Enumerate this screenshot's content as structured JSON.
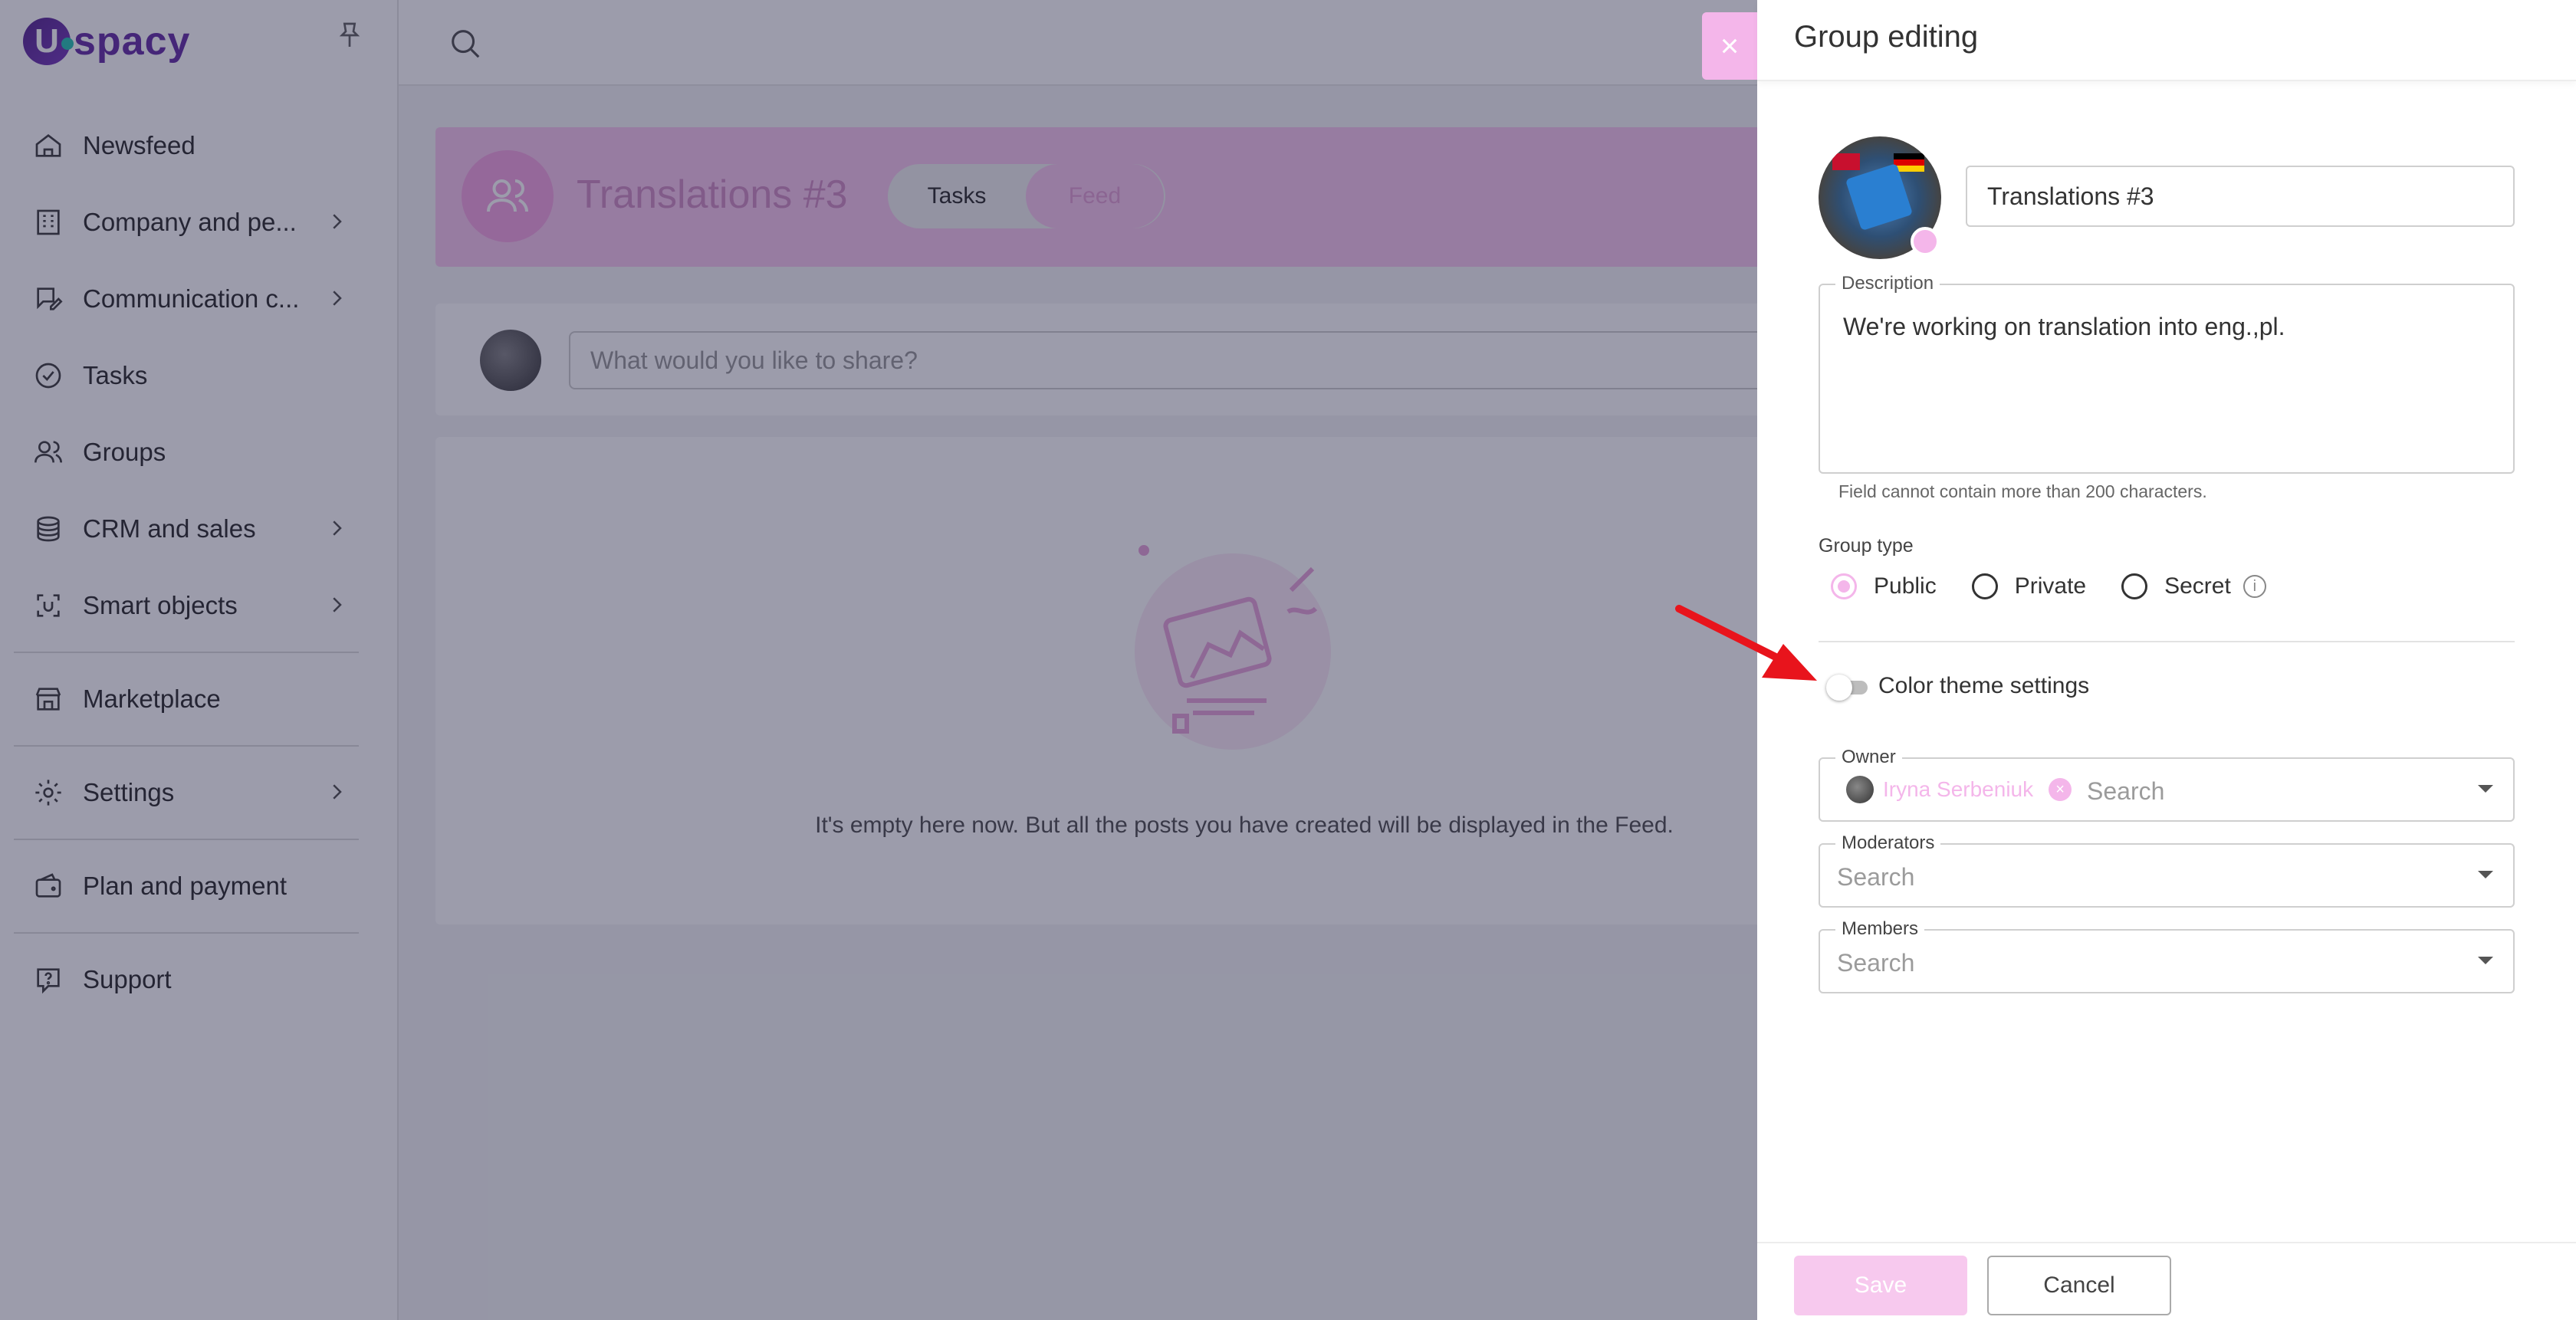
{
  "brand": {
    "logo_letter": "U",
    "logo_text": "spacy"
  },
  "sidebar": {
    "items": [
      {
        "label": "Newsfeed",
        "icon": "home-icon",
        "chevron": false
      },
      {
        "label": "Company and pe...",
        "icon": "building-icon",
        "chevron": true
      },
      {
        "label": "Communication c...",
        "icon": "chat-pen-icon",
        "chevron": true
      },
      {
        "label": "Tasks",
        "icon": "check-circle-icon",
        "chevron": false
      },
      {
        "label": "Groups",
        "icon": "users-icon",
        "chevron": false
      },
      {
        "label": "CRM and sales",
        "icon": "coins-icon",
        "chevron": true
      },
      {
        "label": "Smart objects",
        "icon": "scan-icon",
        "chevron": true
      },
      {
        "label": "Marketplace",
        "icon": "store-icon",
        "chevron": false
      },
      {
        "label": "Settings",
        "icon": "gear-icon",
        "chevron": true
      },
      {
        "label": "Plan and payment",
        "icon": "wallet-icon",
        "chevron": false
      },
      {
        "label": "Support",
        "icon": "help-icon",
        "chevron": false
      }
    ]
  },
  "group": {
    "title": "Translations #3",
    "tabs": {
      "tasks": "Tasks",
      "feed": "Feed"
    },
    "composer_placeholder": "What would you like to share?",
    "empty_text": "It's empty here now. But all the posts you have created will be displayed in the Feed."
  },
  "overlay": {
    "close_glyph": "×"
  },
  "drawer": {
    "title": "Group editing",
    "name_value": "Translations #3",
    "description_label": "Description",
    "description_value": "We're working on translation into eng.,pl.",
    "description_hint": "Field cannot contain more than 200 characters.",
    "group_type_label": "Group type",
    "group_types": [
      {
        "label": "Public",
        "checked": true
      },
      {
        "label": "Private",
        "checked": false
      },
      {
        "label": "Secret",
        "checked": false
      }
    ],
    "info_glyph": "i",
    "color_theme_label": "Color theme settings",
    "color_theme_enabled": false,
    "owner_label": "Owner",
    "owner_name": "Iryna Serbeniuk",
    "owner_remove_glyph": "×",
    "owner_search_placeholder": "Search",
    "moderators_label": "Moderators",
    "moderators_placeholder": "Search",
    "members_label": "Members",
    "members_placeholder": "Search",
    "save_label": "Save",
    "cancel_label": "Cancel"
  },
  "colors": {
    "accent_pink": "#f4b6ea",
    "banner_pink": "#f7c9ee",
    "brand_purple": "#6a35a8",
    "annotation_red": "#e8141c"
  }
}
